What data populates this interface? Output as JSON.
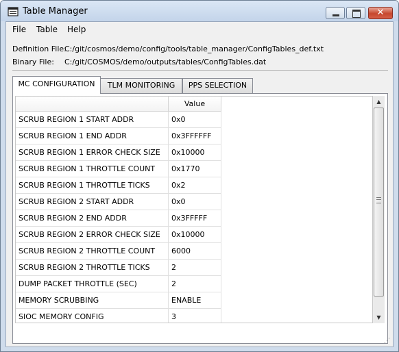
{
  "window": {
    "title": "Table Manager"
  },
  "menu": [
    {
      "label": "File"
    },
    {
      "label": "Table"
    },
    {
      "label": "Help"
    }
  ],
  "info": {
    "definition_label": "Definition File:",
    "definition_value": "C:/git/cosmos/demo/config/tools/table_manager/ConfigTables_def.txt",
    "binary_label": "Binary File:",
    "binary_value": "C:/git/COSMOS/demo/outputs/tables/ConfigTables.dat"
  },
  "tabs": [
    {
      "label": "MC CONFIGURATION",
      "active": true
    },
    {
      "label": "TLM MONITORING",
      "active": false
    },
    {
      "label": "PPS SELECTION",
      "active": false
    }
  ],
  "table": {
    "headers": [
      "",
      "Value"
    ],
    "rows": [
      {
        "name": "SCRUB REGION 1 START ADDR",
        "value": "0x0"
      },
      {
        "name": "SCRUB REGION 1 END ADDR",
        "value": "0x3FFFFFF"
      },
      {
        "name": "SCRUB REGION 1 ERROR CHECK SIZE",
        "value": "0x10000"
      },
      {
        "name": "SCRUB REGION 1 THROTTLE COUNT",
        "value": "0x1770"
      },
      {
        "name": "SCRUB REGION 1 THROTTLE TICKS",
        "value": "0x2"
      },
      {
        "name": "SCRUB REGION 2 START ADDR",
        "value": "0x0"
      },
      {
        "name": "SCRUB REGION 2 END ADDR",
        "value": "0x3FFFFF"
      },
      {
        "name": "SCRUB REGION 2 ERROR CHECK SIZE",
        "value": "0x10000"
      },
      {
        "name": "SCRUB REGION 2 THROTTLE COUNT",
        "value": "6000"
      },
      {
        "name": "SCRUB REGION 2 THROTTLE TICKS",
        "value": "2"
      },
      {
        "name": "DUMP PACKET THROTTLE (SEC)",
        "value": "2"
      },
      {
        "name": "MEMORY SCRUBBING",
        "value": "ENABLE"
      },
      {
        "name": "SIOC MEMORY CONFIG",
        "value": "3"
      }
    ]
  },
  "icons": {
    "app": "app-window-icon",
    "minimize": "minimize-icon",
    "maximize": "maximize-icon",
    "close": "close-icon",
    "scroll_up": "scroll-up-arrow-icon",
    "scroll_down": "scroll-down-arrow-icon"
  },
  "colors": {
    "titlebar": "#c3d4ea",
    "close_button": "#c7472e",
    "client": "#f0f0f0"
  }
}
